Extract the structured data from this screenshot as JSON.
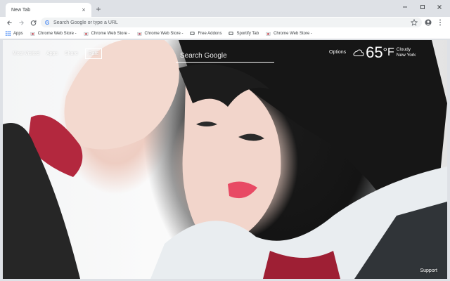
{
  "browser": {
    "tab": {
      "title": "New Tab",
      "close_icon": "×"
    },
    "new_tab_icon": "+",
    "omnibox": {
      "placeholder": "Search Google or type a URL",
      "engine_glyph": "G"
    },
    "bookmarks": [
      {
        "label": "Apps",
        "icon": "apps-grid-icon"
      },
      {
        "label": "Chrome Web Store -",
        "icon": "chrome-store-icon"
      },
      {
        "label": "Chrome Web Store -",
        "icon": "chrome-store-icon"
      },
      {
        "label": "Chrome Web Store -",
        "icon": "chrome-store-icon"
      },
      {
        "label": "Free Addons",
        "icon": "addon-icon"
      },
      {
        "label": "Sportify Tab",
        "icon": "addon-icon"
      },
      {
        "label": "Chrome Web Store -",
        "icon": "chrome-store-icon"
      }
    ]
  },
  "newtab": {
    "links": {
      "most_visited": "Most Visited",
      "apps": "Apps",
      "share": "Share",
      "rate": "Rate"
    },
    "search": {
      "placeholder": "Search Google"
    },
    "weather": {
      "options": "Options",
      "temperature": "65",
      "unit": "°F",
      "condition": "Cloudy",
      "city": "New York"
    },
    "support": "Support"
  },
  "colors": {
    "chrome_frame": "#dee1e6",
    "toolbar": "#ffffff",
    "omnibox": "#f1f3f4",
    "overlay_text": "#ffffff"
  }
}
